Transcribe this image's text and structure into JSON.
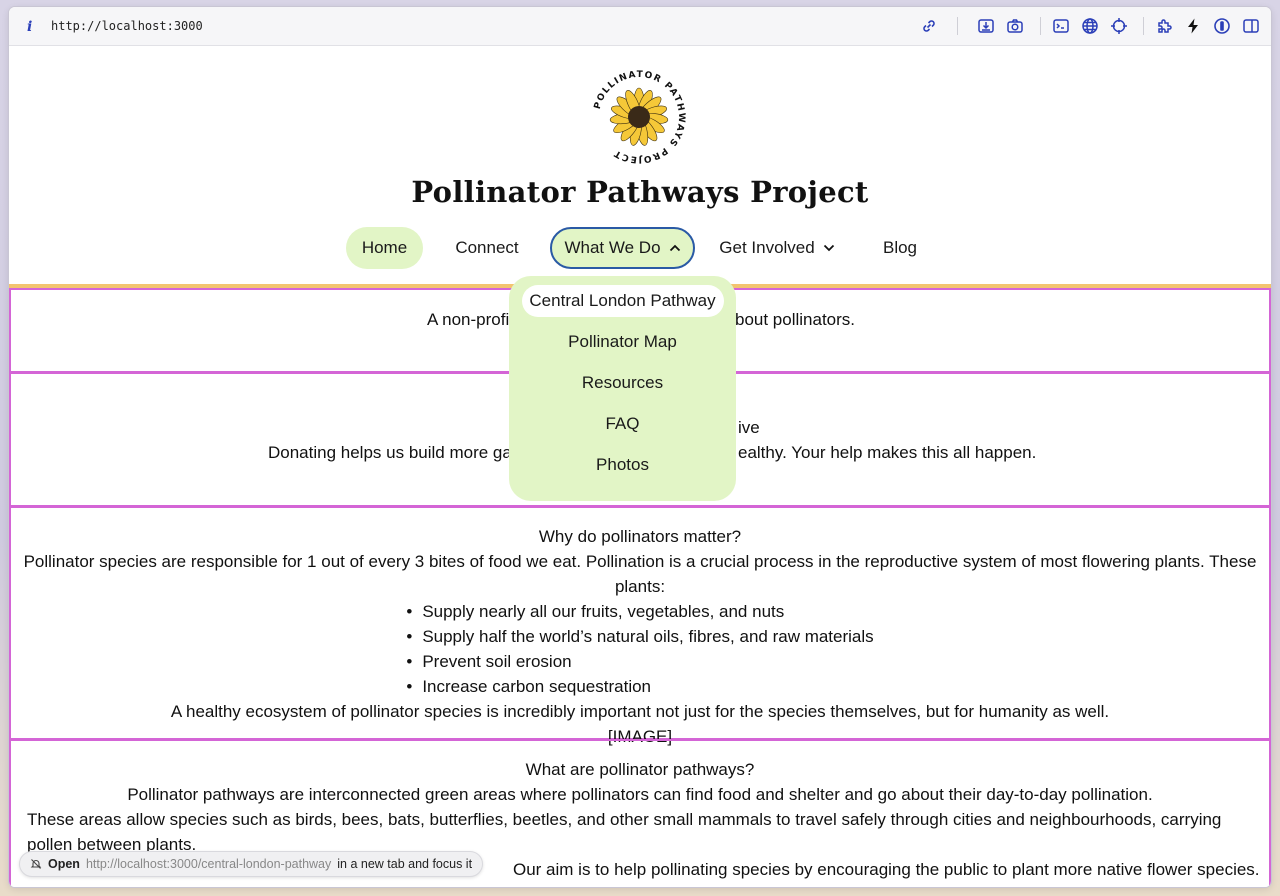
{
  "browser": {
    "url": "http://localhost:3000",
    "toolbar_icons": [
      "link-icon",
      "download-icon",
      "camera-icon",
      "terminal-icon",
      "globe-icon",
      "crosshair-icon",
      "extension-icon",
      "bolt-icon",
      "password-manager-icon",
      "sidebar-icon"
    ]
  },
  "site": {
    "title": "Pollinator Pathways Project",
    "logo_text": "POLLINATOR PATHWAYS PROJECT"
  },
  "nav": {
    "home": "Home",
    "connect": "Connect",
    "what_we_do": "What We Do",
    "get_involved": "Get Involved",
    "blog": "Blog"
  },
  "dropdown": {
    "items": [
      "Central London Pathway",
      "Pollinator Map",
      "Resources",
      "FAQ",
      "Photos"
    ]
  },
  "sections": {
    "intro": {
      "left_fragment": "A non-profi",
      "right_fragment": "bout pollinators."
    },
    "donate": {
      "heading_fragment": "ive",
      "left_fragment": "Donating helps us build more garc",
      "right_fragment": "ealthy. Your help makes this all happen."
    },
    "why": {
      "heading": "Why do pollinators matter?",
      "intro": "Pollinator species are responsible for 1 out of every 3 bites of food we eat. Pollination is a crucial process in the reproductive system of most flowering plants. These plants:",
      "bullets": [
        "Supply nearly all our fruits, vegetables, and nuts",
        "Supply half the world’s natural oils, fibres, and raw materials",
        "Prevent soil erosion",
        "Increase carbon sequestration"
      ],
      "conclusion": "A healthy ecosystem of pollinator species is incredibly important not just for the species themselves, but for humanity as well.",
      "image_placeholder": "[IMAGE]"
    },
    "what": {
      "heading": "What are pollinator pathways?",
      "line1": "Pollinator pathways are interconnected green areas where pollinators can find food and shelter and go about their day-to-day pollination.",
      "line2": "These areas allow species such as birds, bees, bats, butterflies, beetles, and other small mammals to travel safely through cities and neighbourhoods, carrying pollen between plants.",
      "line3": "Our aim is to help pollinating species by encouraging the public to plant more native flower species."
    }
  },
  "status_tip": {
    "open": "Open",
    "url": "http://localhost:3000/central-london-pathway",
    "suffix": "in a new tab and focus it"
  },
  "colors": {
    "nav_active_bg": "#e2f5c6",
    "focus_ring": "#2a5aa5",
    "section_border": "#d465d6",
    "header_rule": "#f3c470"
  }
}
